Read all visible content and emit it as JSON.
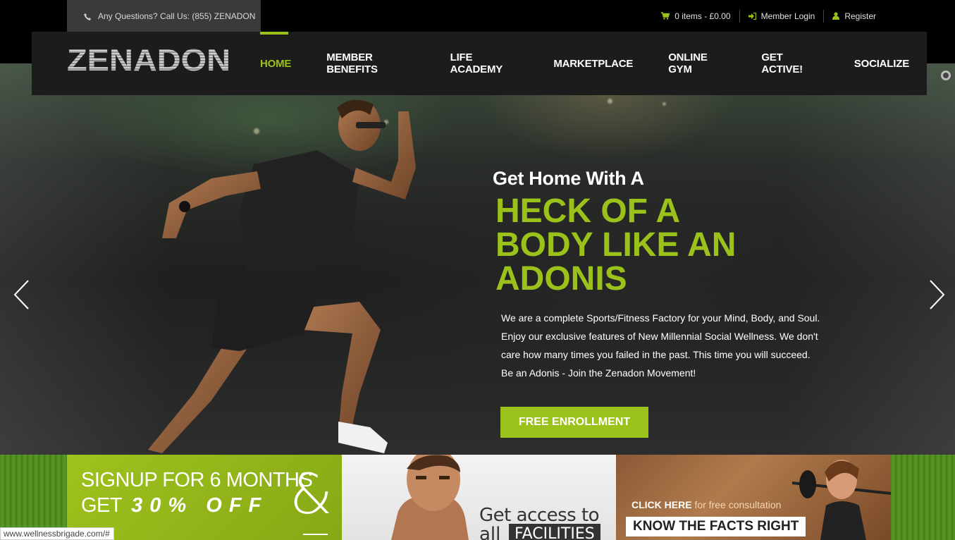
{
  "topbar": {
    "phone_text": "Any Questions? Call Us: (855) ZENADON",
    "cart_text": "0 items - £0.00",
    "login_text": "Member Login",
    "register_text": "Register"
  },
  "logo": {
    "text": "ZENADON"
  },
  "nav": {
    "items": [
      {
        "label": "HOME",
        "active": true
      },
      {
        "label": "MEMBER BENEFITS"
      },
      {
        "label": "LIFE ACADEMY"
      },
      {
        "label": "MARKETPLACE"
      },
      {
        "label": "ONLINE GYM"
      },
      {
        "label": "GET ACTIVE!"
      },
      {
        "label": "SOCIALIZE"
      }
    ]
  },
  "hero": {
    "subtitle": "Get Home With A",
    "headline_lines": [
      "HECK OF A",
      "BODY LIKE AN",
      "ADONIS"
    ],
    "description_lines": [
      "We are a complete Sports/Fitness Factory for your Mind, Body, and Soul.",
      "Enjoy our exclusive features of New Millennial Social Wellness. We don't",
      "care how many times you failed in the past. This time you will succeed.",
      "Be an Adonis - Join the Zenadon Movement!"
    ],
    "button_label": "FREE ENROLLMENT"
  },
  "banners": {
    "signup": {
      "line1": "SIGNUP FOR 6 MONTHS",
      "line2_prefix": "GET",
      "line2_offer": "30% OFF",
      "amp": "&"
    },
    "access": {
      "line1": "Get access to",
      "line2_prefix": "all",
      "line2_highlight": "FACILITIES"
    },
    "consult": {
      "click_bold": "CLICK HERE",
      "click_rest": " for free consultation",
      "facts": "KNOW THE FACTS RIGHT"
    }
  },
  "status_url": "www.wellnessbrigade.com/#",
  "colors": {
    "accent": "#9bc21a",
    "navbar": "#1b1c1b",
    "phone_box": "#3a3a3a"
  }
}
